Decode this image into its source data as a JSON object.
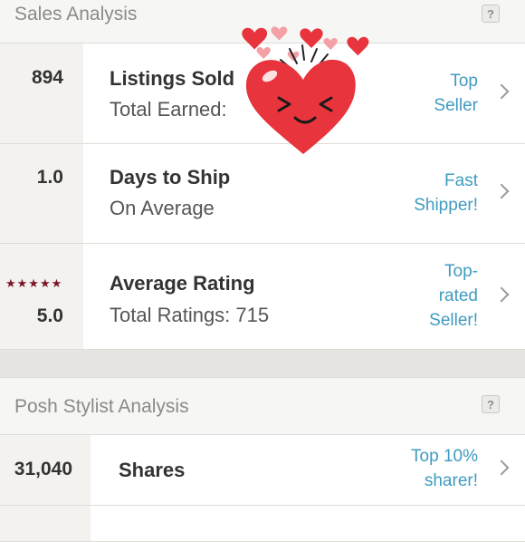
{
  "sales": {
    "title": "Sales Analysis",
    "help": "?",
    "rows": [
      {
        "stat": "894",
        "title": "Listings Sold",
        "sub": "Total Earned: ",
        "badge1": "Top",
        "badge2": "Seller"
      },
      {
        "stat": "1.0",
        "title": "Days to Ship",
        "sub": "On Average",
        "badge1": "Fast",
        "badge2": "Shipper!"
      },
      {
        "stat": "5.0",
        "title": "Average Rating",
        "sub": "Total Ratings: 715",
        "badge1": "Top-",
        "badge2": "rated",
        "badge3": "Seller!",
        "stars": "★★★★★"
      }
    ]
  },
  "stylist": {
    "title": "Posh Stylist Analysis",
    "help": "?",
    "rows": [
      {
        "stat": "31,040",
        "title": "Shares",
        "badge1": "Top 10%",
        "badge2": "sharer!"
      }
    ]
  },
  "sticker": {
    "name": "happy heart with hearts",
    "color": "#e8343c"
  }
}
